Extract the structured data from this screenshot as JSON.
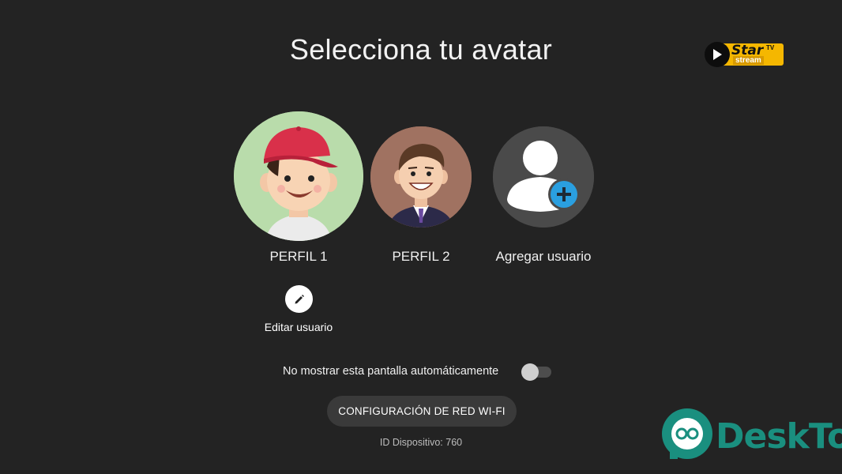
{
  "screen": {
    "title": "Selecciona tu avatar"
  },
  "logo": {
    "brand": "Star",
    "tv": "TV",
    "stream": "stream"
  },
  "profiles": [
    {
      "name": "PERFIL 1",
      "avatar": "boy-red-cap-avatar"
    },
    {
      "name": "PERFIL 2",
      "avatar": "businessman-avatar"
    },
    {
      "name": "Agregar usuario",
      "avatar": "add-user-icon"
    }
  ],
  "edit": {
    "label": "Editar usuario",
    "icon": "pencil-icon"
  },
  "auto_hide": {
    "label": "No mostrar esta pantalla automáticamente",
    "enabled": false
  },
  "wifi_button": {
    "label": "CONFIGURACIÓN DE RED WI-FI"
  },
  "device": {
    "id_text": "ID Dispositivo: 760"
  },
  "watermark": {
    "text": "DeskTop"
  },
  "colors": {
    "background": "#232323",
    "button_bg": "#3a3a3a",
    "logo_yellow": "#f5b700",
    "add_badge_blue": "#2a9fe0",
    "cap_red": "#d9304a",
    "watermark_teal": "#1a8f7f"
  }
}
